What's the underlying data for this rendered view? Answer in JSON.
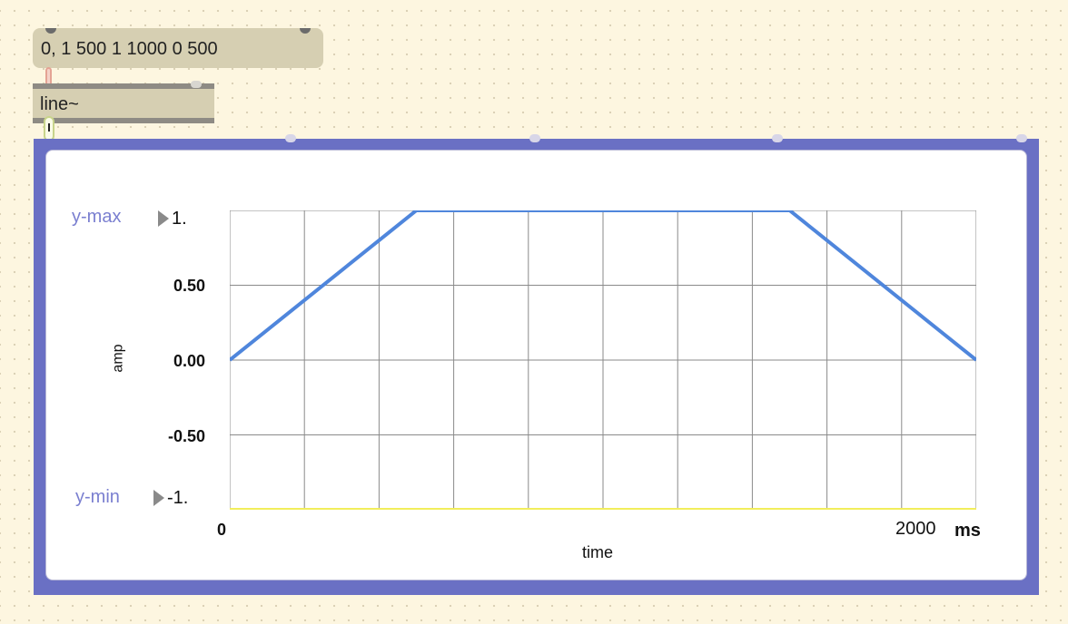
{
  "message_box": {
    "text": "0, 1 500 1 1000 0 500"
  },
  "object_box": {
    "text": "line~"
  },
  "plot": {
    "y_max_label": "y-max",
    "y_max_value": "1.",
    "y_min_label": "y-min",
    "y_min_value": "-1.",
    "y_axis_label": "amp",
    "x_axis_label": "time",
    "x_start_label": "0",
    "x_end_label": "2000",
    "x_unit_label": "ms",
    "y_ticks": [
      "0.50",
      "0.00",
      "-0.50"
    ],
    "line_color": "#4f86dc",
    "frame_color": "#6a70c4",
    "baseline_color": "#f2ee5c"
  },
  "chart_data": {
    "type": "line",
    "title": "",
    "xlabel": "time",
    "ylabel": "amp",
    "xlim": [
      0,
      2000
    ],
    "ylim": [
      -1,
      1
    ],
    "grid": true,
    "series": [
      {
        "x": [
          0,
          500,
          1500,
          2000
        ],
        "values": [
          0,
          1,
          1,
          0
        ]
      }
    ]
  }
}
